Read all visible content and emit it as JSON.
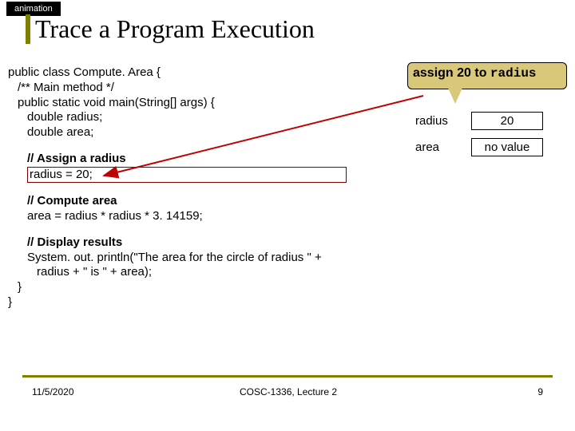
{
  "badge": "animation",
  "title": "Trace a Program Execution",
  "code": {
    "l0": "public class Compute. Area {",
    "l1": "/** Main method */",
    "l2": "public static void main(String[] args) {",
    "l3": "double radius;",
    "l4": "double area;",
    "l5c": "// Assign a radius",
    "l6": "radius = 20;",
    "l7c": "// Compute area",
    "l8": "area = radius * radius * 3. 14159;",
    "l9c": "// Display results",
    "l10": "System. out. println(\"The area for the circle of radius \" +",
    "l11": "radius + \" is \" + area);",
    "l12": "}",
    "l13": "}"
  },
  "callout": {
    "prefix": "assign 20 to ",
    "var": "radius"
  },
  "vars": {
    "r_label": "radius",
    "r_value": "20",
    "a_label": "area",
    "a_value": "no value"
  },
  "footer": {
    "date": "11/5/2020",
    "course": "COSC-1336, Lecture 2",
    "page": "9"
  }
}
